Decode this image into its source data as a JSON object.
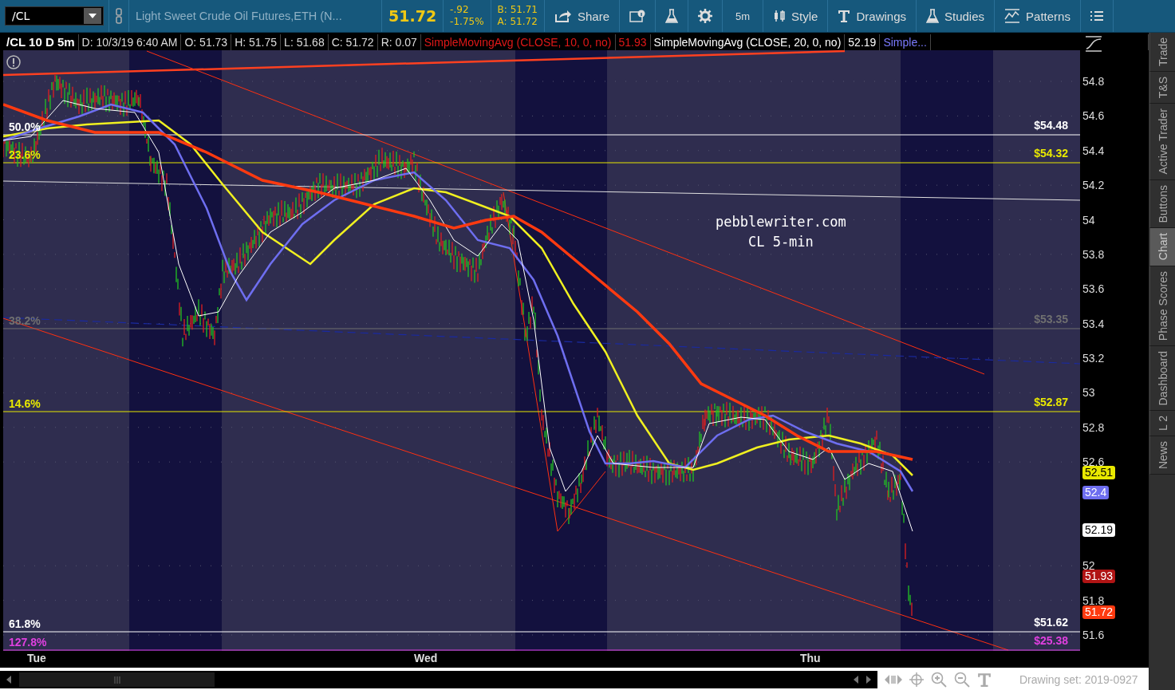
{
  "toolbar": {
    "symbol": "/CL",
    "description": "Light Sweet Crude Oil Futures,ETH (N...",
    "last": "51.72",
    "change": "-.92",
    "change_pct": "-1.75%",
    "bid": "B: 51.71",
    "ask": "A: 51.72",
    "buttons": [
      {
        "kind": "share",
        "label": "Share"
      },
      {
        "kind": "info"
      },
      {
        "kind": "flask"
      },
      {
        "kind": "gear"
      },
      {
        "kind": "text",
        "label": "5m"
      },
      {
        "kind": "style",
        "label": "Style"
      },
      {
        "kind": "drawings",
        "label": "Drawings"
      },
      {
        "kind": "studies",
        "label": "Studies"
      },
      {
        "kind": "patterns",
        "label": "Patterns"
      },
      {
        "kind": "menu"
      }
    ]
  },
  "info_bar": {
    "title": "/CL 10 D 5m",
    "fields": [
      "D: 10/3/19 6:40 AM",
      "O: 51.73",
      "H: 51.75",
      "L: 51.68",
      "C: 51.72",
      "R: 0.07"
    ],
    "studies": [
      {
        "label": "SimpleMovingAvg (CLOSE, 10, 0, no)",
        "value": "51.93",
        "color": "#e01818"
      },
      {
        "label": "SimpleMovingAvg (CLOSE, 20, 0, no)",
        "value": "52.19",
        "color": "#ffffff"
      },
      {
        "label": "Simple...",
        "color": "#7b7bff"
      }
    ]
  },
  "chart": {
    "annotation": [
      "pebblewriter.com",
      "CL 5-min"
    ],
    "fib_levels": [
      {
        "label": "50.0%",
        "price": "$54.48",
        "color": "#ffffff"
      },
      {
        "label": "23.6%",
        "price": "$54.32",
        "color": "#e8e800"
      },
      {
        "label": "38.2%",
        "price": "$53.35",
        "color": "#707070"
      },
      {
        "label": "14.6%",
        "price": "$52.87",
        "color": "#e8e800"
      },
      {
        "label": "61.8%",
        "price": "$51.62",
        "color": "#ffffff"
      },
      {
        "label": "127.8%",
        "price": "$25.38",
        "color": "#e040e0"
      }
    ],
    "y_ticks": [
      "54.8",
      "54.6",
      "54.4",
      "54.2",
      "54",
      "53.8",
      "53.6",
      "53.4",
      "53.2",
      "53",
      "52.8",
      "52.6",
      "52",
      "51.8",
      "51.6"
    ],
    "price_tags": [
      {
        "value": "52.51",
        "color": "#e8e800"
      },
      {
        "value": "52.4",
        "color": "#6e6ef0"
      },
      {
        "value": "52.19",
        "color": "#ffffff"
      },
      {
        "value": "51.93",
        "color": "#b01414"
      },
      {
        "value": "51.72",
        "color": "#ff3a10"
      }
    ],
    "x_labels": [
      "Tue",
      "Wed",
      "Thu"
    ]
  },
  "side_tabs": [
    {
      "label": "Trade",
      "selected": false
    },
    {
      "label": "T&S",
      "selected": false
    },
    {
      "label": "Active Trader",
      "selected": false
    },
    {
      "label": "Buttons",
      "selected": false
    },
    {
      "label": "Chart",
      "selected": true
    },
    {
      "label": "Phase Scores",
      "selected": false
    },
    {
      "label": "Dashboard",
      "selected": false
    },
    {
      "label": "L 2",
      "selected": false
    },
    {
      "label": "News",
      "selected": false
    }
  ],
  "status_bar": {
    "drawing_set": "Drawing set: 2019-0927"
  }
}
